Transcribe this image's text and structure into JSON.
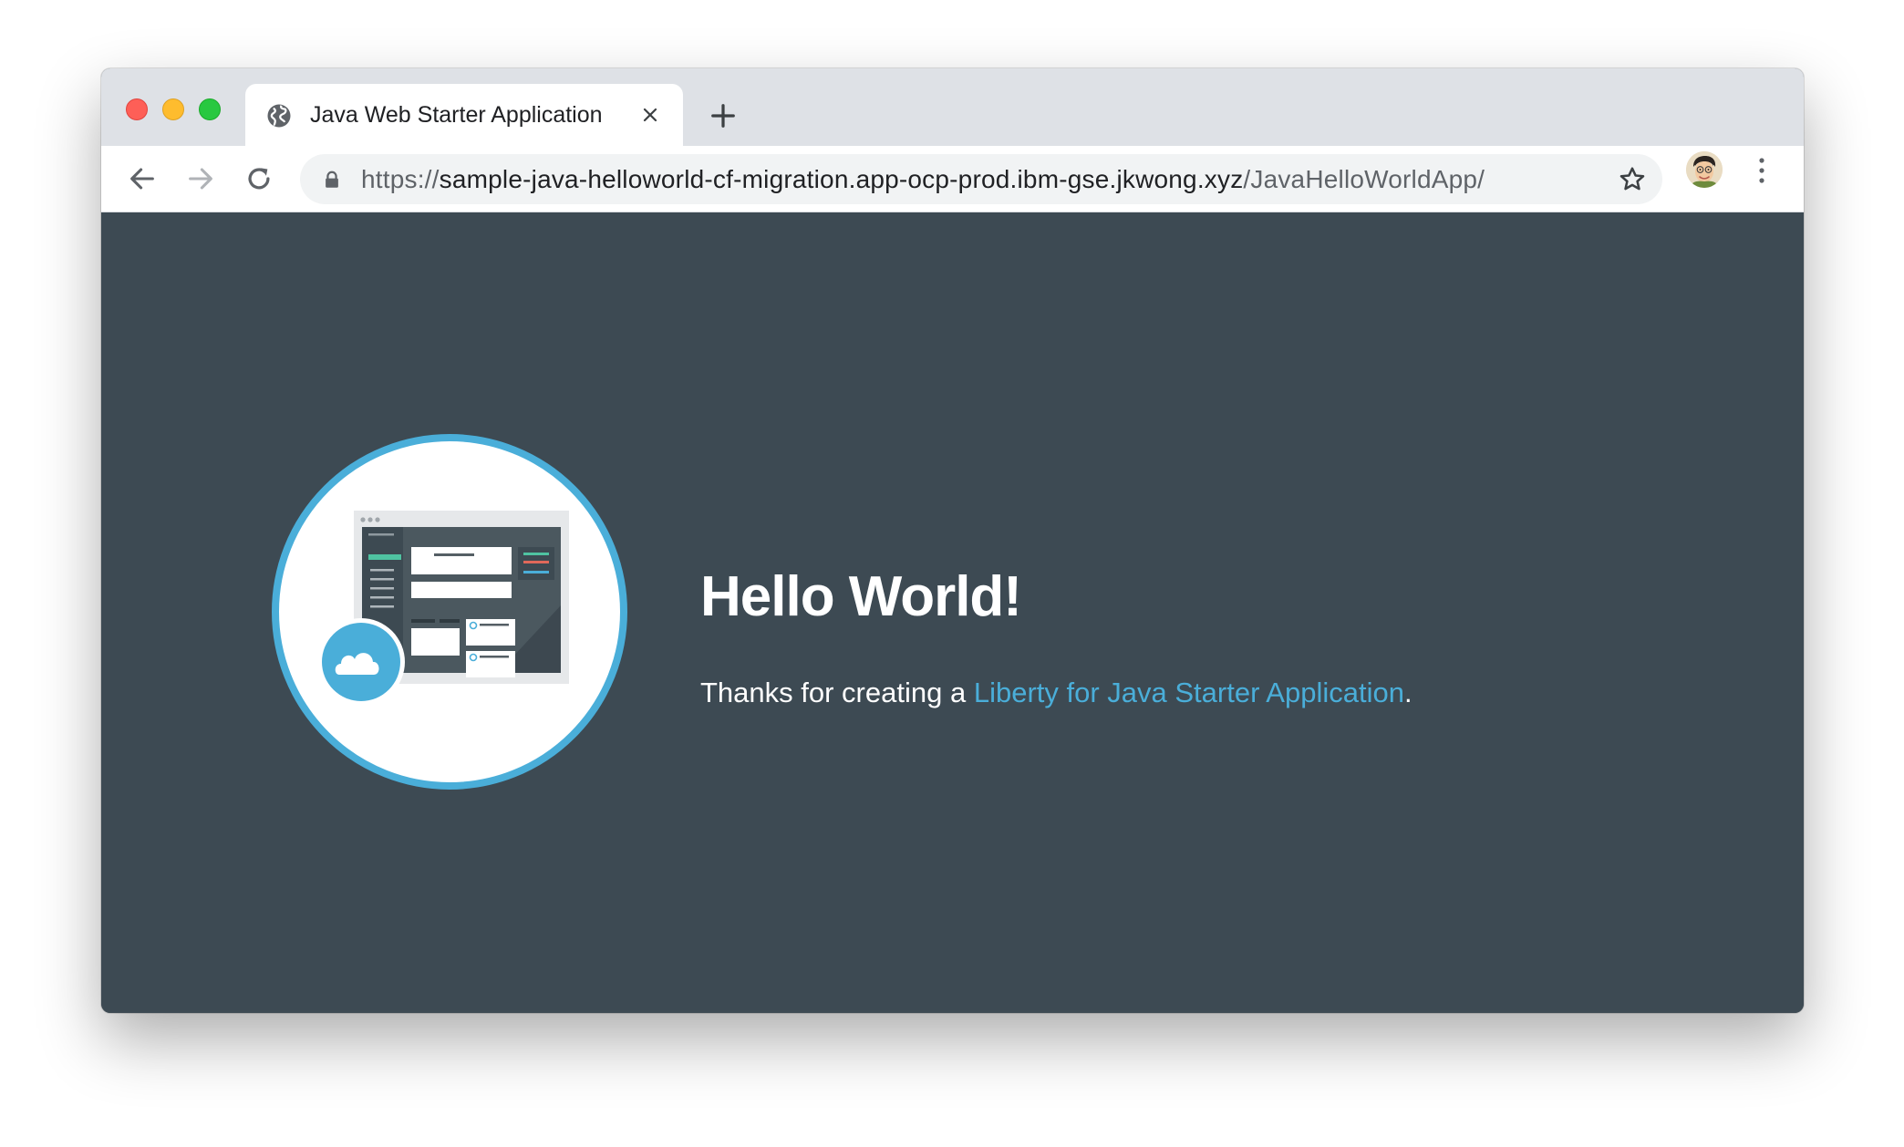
{
  "browser": {
    "tab": {
      "title": "Java Web Starter Application"
    },
    "address_bar": {
      "scheme": "https://",
      "host": "sample-java-helloworld-cf-migration.app-ocp-prod.ibm-gse.jkwong.xyz",
      "path": "/JavaHelloWorldApp/",
      "secure": true
    }
  },
  "page": {
    "heading": "Hello World!",
    "message_prefix": "Thanks for creating a ",
    "link_text": "Liberty for Java Starter Application",
    "message_suffix": ".",
    "background_color": "#3d4a53",
    "accent_color": "#4aaed9"
  }
}
